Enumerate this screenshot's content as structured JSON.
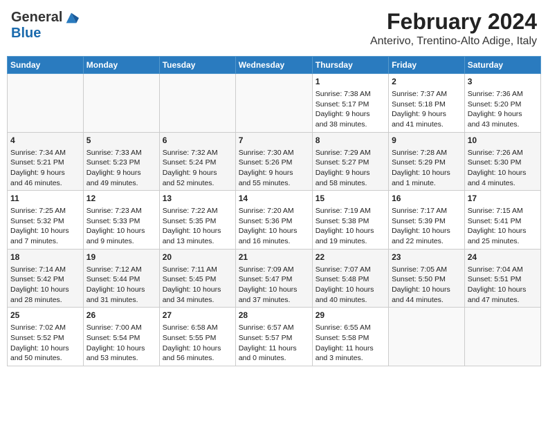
{
  "header": {
    "logo": {
      "general": "General",
      "blue": "Blue"
    },
    "title": "February 2024",
    "location": "Anterivo, Trentino-Alto Adige, Italy"
  },
  "days_of_week": [
    "Sunday",
    "Monday",
    "Tuesday",
    "Wednesday",
    "Thursday",
    "Friday",
    "Saturday"
  ],
  "weeks": [
    [
      {
        "day": "",
        "info": ""
      },
      {
        "day": "",
        "info": ""
      },
      {
        "day": "",
        "info": ""
      },
      {
        "day": "",
        "info": ""
      },
      {
        "day": "1",
        "info": "Sunrise: 7:38 AM\nSunset: 5:17 PM\nDaylight: 9 hours\nand 38 minutes."
      },
      {
        "day": "2",
        "info": "Sunrise: 7:37 AM\nSunset: 5:18 PM\nDaylight: 9 hours\nand 41 minutes."
      },
      {
        "day": "3",
        "info": "Sunrise: 7:36 AM\nSunset: 5:20 PM\nDaylight: 9 hours\nand 43 minutes."
      }
    ],
    [
      {
        "day": "4",
        "info": "Sunrise: 7:34 AM\nSunset: 5:21 PM\nDaylight: 9 hours\nand 46 minutes."
      },
      {
        "day": "5",
        "info": "Sunrise: 7:33 AM\nSunset: 5:23 PM\nDaylight: 9 hours\nand 49 minutes."
      },
      {
        "day": "6",
        "info": "Sunrise: 7:32 AM\nSunset: 5:24 PM\nDaylight: 9 hours\nand 52 minutes."
      },
      {
        "day": "7",
        "info": "Sunrise: 7:30 AM\nSunset: 5:26 PM\nDaylight: 9 hours\nand 55 minutes."
      },
      {
        "day": "8",
        "info": "Sunrise: 7:29 AM\nSunset: 5:27 PM\nDaylight: 9 hours\nand 58 minutes."
      },
      {
        "day": "9",
        "info": "Sunrise: 7:28 AM\nSunset: 5:29 PM\nDaylight: 10 hours\nand 1 minute."
      },
      {
        "day": "10",
        "info": "Sunrise: 7:26 AM\nSunset: 5:30 PM\nDaylight: 10 hours\nand 4 minutes."
      }
    ],
    [
      {
        "day": "11",
        "info": "Sunrise: 7:25 AM\nSunset: 5:32 PM\nDaylight: 10 hours\nand 7 minutes."
      },
      {
        "day": "12",
        "info": "Sunrise: 7:23 AM\nSunset: 5:33 PM\nDaylight: 10 hours\nand 9 minutes."
      },
      {
        "day": "13",
        "info": "Sunrise: 7:22 AM\nSunset: 5:35 PM\nDaylight: 10 hours\nand 13 minutes."
      },
      {
        "day": "14",
        "info": "Sunrise: 7:20 AM\nSunset: 5:36 PM\nDaylight: 10 hours\nand 16 minutes."
      },
      {
        "day": "15",
        "info": "Sunrise: 7:19 AM\nSunset: 5:38 PM\nDaylight: 10 hours\nand 19 minutes."
      },
      {
        "day": "16",
        "info": "Sunrise: 7:17 AM\nSunset: 5:39 PM\nDaylight: 10 hours\nand 22 minutes."
      },
      {
        "day": "17",
        "info": "Sunrise: 7:15 AM\nSunset: 5:41 PM\nDaylight: 10 hours\nand 25 minutes."
      }
    ],
    [
      {
        "day": "18",
        "info": "Sunrise: 7:14 AM\nSunset: 5:42 PM\nDaylight: 10 hours\nand 28 minutes."
      },
      {
        "day": "19",
        "info": "Sunrise: 7:12 AM\nSunset: 5:44 PM\nDaylight: 10 hours\nand 31 minutes."
      },
      {
        "day": "20",
        "info": "Sunrise: 7:11 AM\nSunset: 5:45 PM\nDaylight: 10 hours\nand 34 minutes."
      },
      {
        "day": "21",
        "info": "Sunrise: 7:09 AM\nSunset: 5:47 PM\nDaylight: 10 hours\nand 37 minutes."
      },
      {
        "day": "22",
        "info": "Sunrise: 7:07 AM\nSunset: 5:48 PM\nDaylight: 10 hours\nand 40 minutes."
      },
      {
        "day": "23",
        "info": "Sunrise: 7:05 AM\nSunset: 5:50 PM\nDaylight: 10 hours\nand 44 minutes."
      },
      {
        "day": "24",
        "info": "Sunrise: 7:04 AM\nSunset: 5:51 PM\nDaylight: 10 hours\nand 47 minutes."
      }
    ],
    [
      {
        "day": "25",
        "info": "Sunrise: 7:02 AM\nSunset: 5:52 PM\nDaylight: 10 hours\nand 50 minutes."
      },
      {
        "day": "26",
        "info": "Sunrise: 7:00 AM\nSunset: 5:54 PM\nDaylight: 10 hours\nand 53 minutes."
      },
      {
        "day": "27",
        "info": "Sunrise: 6:58 AM\nSunset: 5:55 PM\nDaylight: 10 hours\nand 56 minutes."
      },
      {
        "day": "28",
        "info": "Sunrise: 6:57 AM\nSunset: 5:57 PM\nDaylight: 11 hours\nand 0 minutes."
      },
      {
        "day": "29",
        "info": "Sunrise: 6:55 AM\nSunset: 5:58 PM\nDaylight: 11 hours\nand 3 minutes."
      },
      {
        "day": "",
        "info": ""
      },
      {
        "day": "",
        "info": ""
      }
    ]
  ]
}
